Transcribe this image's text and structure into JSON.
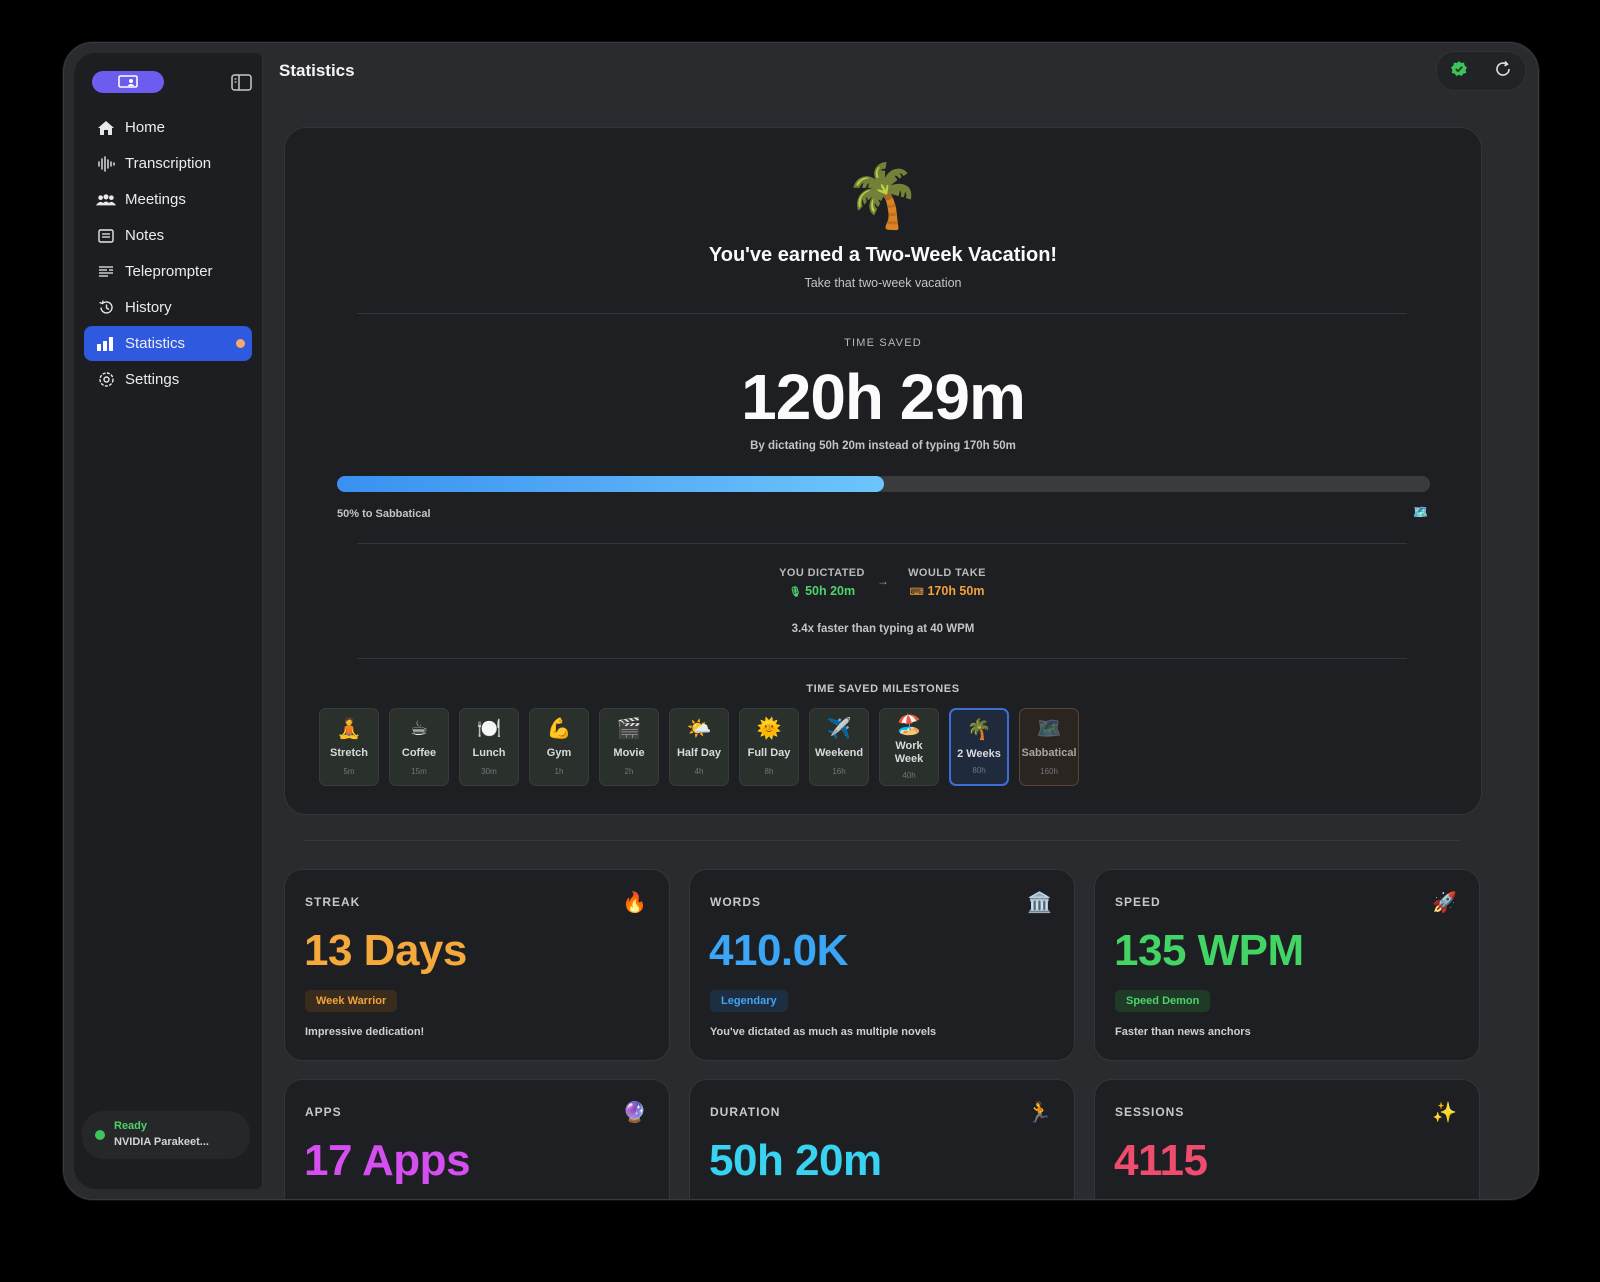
{
  "app": {
    "title": "Statistics"
  },
  "sidebar": {
    "items": [
      {
        "label": "Home",
        "icon": "house-icon"
      },
      {
        "label": "Transcription",
        "icon": "waveform-icon"
      },
      {
        "label": "Meetings",
        "icon": "people-icon"
      },
      {
        "label": "Notes",
        "icon": "notes-icon"
      },
      {
        "label": "Teleprompter",
        "icon": "teleprompter-icon"
      },
      {
        "label": "History",
        "icon": "history-icon"
      },
      {
        "label": "Statistics",
        "icon": "bar-chart-icon",
        "active": true
      },
      {
        "label": "Settings",
        "icon": "gear-icon"
      }
    ],
    "status": {
      "state": "Ready",
      "model": "NVIDIA Parakeet..."
    }
  },
  "hero": {
    "emoji": "🌴",
    "title": "You've earned a Two-Week Vacation!",
    "subtitle": "Take that two-week vacation",
    "time_saved_label": "TIME SAVED",
    "time_saved_value": "120h 29m",
    "time_saved_note": "By dictating 50h 20m instead of typing 170h 50m",
    "progress_percent": 50,
    "progress_label": "50% to Sabbatical",
    "progress_goal_emoji": "🗺️",
    "dictated_label": "YOU DICTATED",
    "dictated_value": "50h 20m",
    "would_take_label": "WOULD TAKE",
    "would_take_value": "170h 50m",
    "speed_note": "3.4x faster than typing at 40 WPM",
    "milestones_label": "TIME SAVED MILESTONES",
    "milestones": [
      {
        "emoji": "🧘",
        "label": "Stretch",
        "hours": "5m"
      },
      {
        "emoji": "☕",
        "label": "Coffee",
        "hours": "15m"
      },
      {
        "emoji": "🍽️",
        "label": "Lunch",
        "hours": "30m"
      },
      {
        "emoji": "💪",
        "label": "Gym",
        "hours": "1h"
      },
      {
        "emoji": "🎬",
        "label": "Movie",
        "hours": "2h"
      },
      {
        "emoji": "🌤️",
        "label": "Half Day",
        "hours": "4h"
      },
      {
        "emoji": "🌞",
        "label": "Full Day",
        "hours": "8h"
      },
      {
        "emoji": "✈️",
        "label": "Weekend",
        "hours": "16h"
      },
      {
        "emoji": "🏖️",
        "label": "Work Week",
        "hours": "40h"
      },
      {
        "emoji": "🌴",
        "label": "2 Weeks",
        "hours": "80h",
        "current": true
      },
      {
        "emoji": "🗺️",
        "label": "Sabbatical",
        "hours": "160h",
        "locked": true
      }
    ]
  },
  "cards": [
    {
      "label": "STREAK",
      "icon": "🔥",
      "value": "13 Days",
      "color": "#f5a93c",
      "badge": "Week Warrior",
      "badge_bg": "#3a2c1d",
      "badge_fg": "#f2a23c",
      "desc": "Impressive dedication!"
    },
    {
      "label": "WORDS",
      "icon": "🏛️",
      "value": "410.0K",
      "color": "#3aa6f5",
      "badge": "Legendary",
      "badge_bg": "#1d2e42",
      "badge_fg": "#43a3f0",
      "desc": "You've dictated as much as multiple novels"
    },
    {
      "label": "SPEED",
      "icon": "🚀",
      "value": "135 WPM",
      "color": "#43d466",
      "badge": "Speed Demon",
      "badge_bg": "#1f3a26",
      "badge_fg": "#4fd26c",
      "desc": "Faster than news anchors"
    },
    {
      "label": "APPS",
      "icon": "🔮",
      "value": "17 Apps",
      "color": "#d44ef0",
      "desc": ""
    },
    {
      "label": "DURATION",
      "icon": "🏃",
      "value": "50h 20m",
      "color": "#38d3f0",
      "desc": ""
    },
    {
      "label": "SESSIONS",
      "icon": "✨",
      "value": "4115",
      "color": "#f04c6e",
      "desc": ""
    }
  ]
}
